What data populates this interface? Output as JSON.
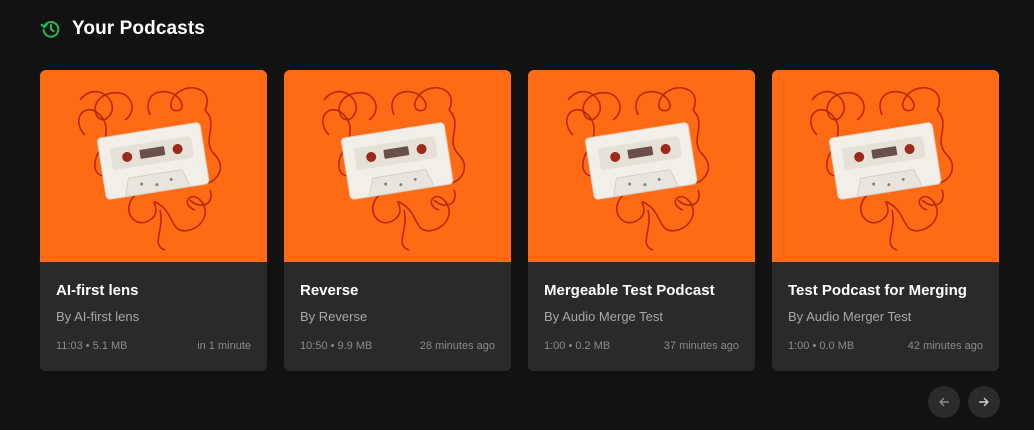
{
  "section": {
    "title": "Your Podcasts",
    "icon": "history-icon",
    "icon_color": "#1db954"
  },
  "podcasts": [
    {
      "title": "AI-first lens",
      "author": "By AI-first lens",
      "duration_size": "11:03 • 5.1 MB",
      "when": "in 1 minute"
    },
    {
      "title": "Reverse",
      "author": "By Reverse",
      "duration_size": "10:50 • 9.9 MB",
      "when": "28 minutes ago"
    },
    {
      "title": "Mergeable Test Podcast",
      "author": "By Audio Merge Test",
      "duration_size": "1:00 • 0.2 MB",
      "when": "37 minutes ago"
    },
    {
      "title": "Test Podcast for Merging",
      "author": "By Audio Merger Test",
      "duration_size": "1:00 • 0.0 MB",
      "when": "42 minutes ago"
    }
  ],
  "navigation": {
    "prev_icon": "arrow-left-icon",
    "next_icon": "arrow-right-icon"
  },
  "colors": {
    "background": "#121212",
    "card": "#2a2a2a",
    "artwork": "#ff6a14"
  }
}
